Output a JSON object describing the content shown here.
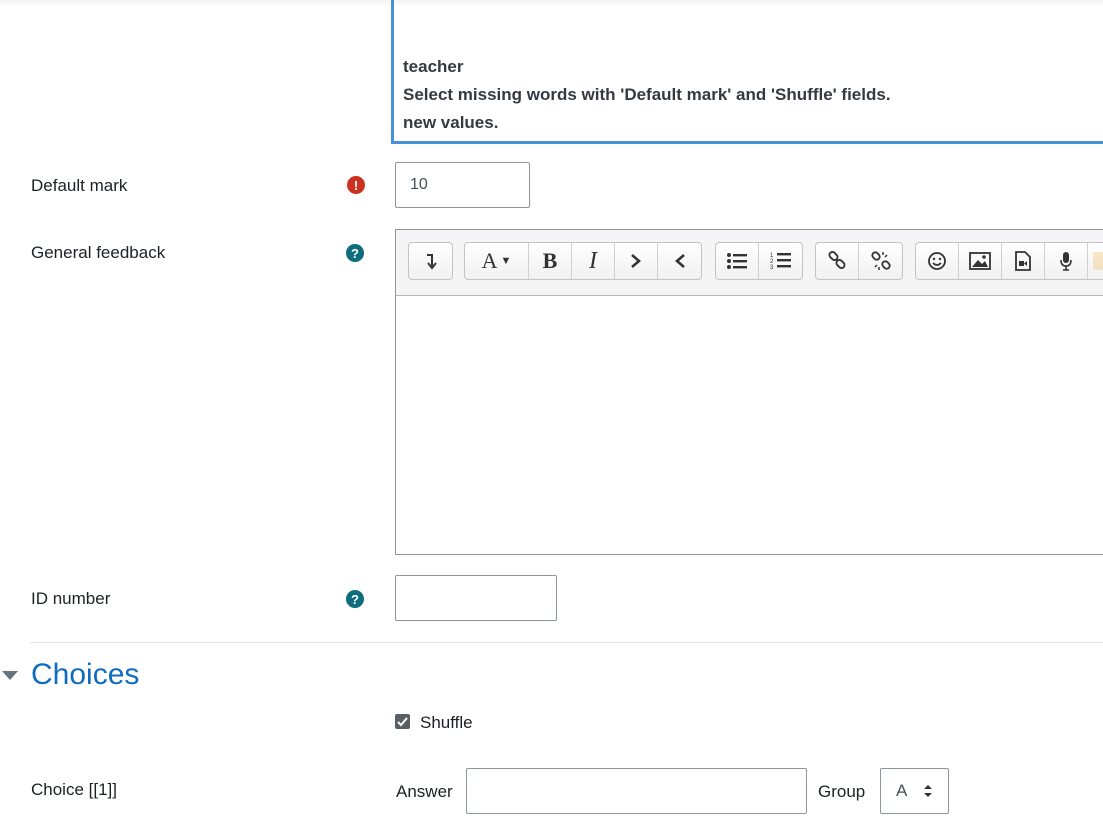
{
  "question_text": {
    "lines": [
      "teacher",
      "Select missing words with 'Default mark' and 'Shuffle' fields.",
      "new values."
    ]
  },
  "default_mark": {
    "label": "Default mark",
    "value": "10",
    "required_icon": "exclamation-circle-icon"
  },
  "general_feedback": {
    "label": "General feedback",
    "help_icon": "question-circle-icon",
    "toolbar": {
      "groups": [
        [
          "collapse-icon"
        ],
        [
          "font-style-icon",
          "bold-icon",
          "italic-icon",
          "indent-icon",
          "outdent-icon"
        ],
        [
          "unordered-list-icon",
          "ordered-list-icon"
        ],
        [
          "link-icon",
          "unlink-icon"
        ],
        [
          "emoji-icon",
          "image-icon",
          "media-icon",
          "record-audio-icon"
        ]
      ]
    },
    "content": ""
  },
  "id_number": {
    "label": "ID number",
    "value": "",
    "help_icon": "question-circle-icon"
  },
  "choices": {
    "title": "Choices",
    "shuffle": {
      "label": "Shuffle",
      "checked": true
    },
    "choice_1": {
      "label": "Choice [[1]]",
      "answer_label": "Answer",
      "answer_value": "",
      "group_label": "Group",
      "group_value": "A"
    }
  },
  "colors": {
    "accent": "#0f6cbf",
    "error": "#ca3120",
    "help": "#0f6c7c",
    "focus": "#4a90d9"
  }
}
